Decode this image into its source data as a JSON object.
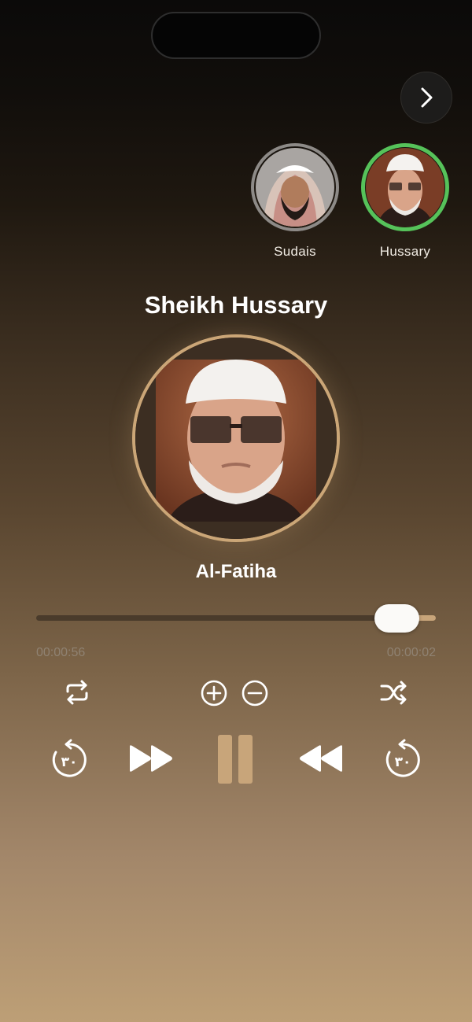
{
  "header": {
    "next_icon": "chevron-right-icon"
  },
  "reciters": [
    {
      "name": "Sudais",
      "selected": false
    },
    {
      "name": "Hussary",
      "selected": true
    }
  ],
  "now_playing": {
    "reciter_title": "Sheikh Hussary",
    "surah": "Al-Fatiha",
    "elapsed": "00:00:56",
    "remaining": "00:00:02",
    "progress": 0.93
  },
  "controls": {
    "row1": [
      "repeat-icon",
      "zoom-in-icon",
      "zoom-out-icon",
      "shuffle-icon"
    ],
    "row2": [
      "skip-30-icon",
      "fast-forward-icon",
      "pause-icon",
      "rewind-icon",
      "skip-30-icon"
    ],
    "skip_label": "٣٠"
  },
  "colors": {
    "accent": "#c8a57a",
    "selected_ring": "#56c25a"
  }
}
